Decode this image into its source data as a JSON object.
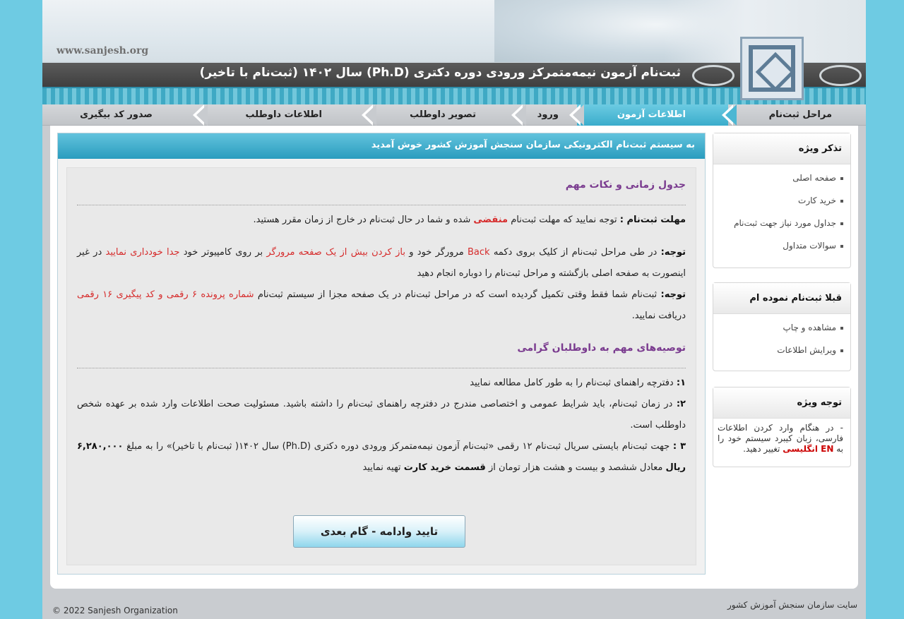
{
  "header": {
    "site_url": "www.sanjesh.org",
    "title": "ثبت‌نام آزمون نیمه‌متمرکز ورودی دوره دکتری (Ph.D) سال ۱۴۰۲ (ثبت‌نام با تاخیر)"
  },
  "nav": {
    "items": [
      {
        "label": "مراحل ثبت‌نام"
      },
      {
        "label": "اطلاعات آزمون"
      },
      {
        "label": "ورود"
      },
      {
        "label": "تصویر داوطلب"
      },
      {
        "label": "اطلاعات داوطلب"
      },
      {
        "label": "صدور کد بیگیری"
      }
    ],
    "active_index": 1
  },
  "sidebar": {
    "boxes": [
      {
        "title": "تذکر ویژه",
        "items": [
          "صفحه اصلی",
          "خرید کارت",
          "جداول مورد نیاز جهت ثبت‌نام",
          "سوالات متداول"
        ]
      },
      {
        "title": "قبلا ثبت‌نام نموده ام",
        "items": [
          "مشاهده و چاپ",
          "ویرایش اطلاعات"
        ]
      }
    ],
    "note_box": {
      "title": "توجه ویژه",
      "text_before": "- در هنگام وارد کردن اطلاعات فارسی، زبان کیبرد سیستم خود را به",
      "en_label": "EN انگلیسی",
      "text_after": "تغییر دهید."
    }
  },
  "main": {
    "welcome": "به سیستم ثبت‌نام الکترونیکی سازمان سنجش آموزش کشور خوش آمدید",
    "section1_title": "جدول زمانی و نکات مهم",
    "deadline": {
      "label": "مهلت ثبت‌نام :",
      "text1": "توجه نمایید که مهلت ثبت‌نام",
      "highlight": "منقضی",
      "text2": "شده و شما در حال ثبت‌نام در خارج از زمان مقرر هستید."
    },
    "note1": {
      "label": "توجه:",
      "t1": "در طی مراحل ثبت‌نام از کلیک بروی دکمه",
      "back": "Back",
      "t2": "مرورگر خود و",
      "r1": "باز کردن بیش از یک صفحه مرورگر",
      "t3": "بر روی کامپیوتر خود",
      "r2": "جدا خودداری نمایید",
      "t4": "در غیر اینصورت به صفحه اصلی بازگشته و مراحل ثبت‌نام را دوباره انجام دهید"
    },
    "note2": {
      "label": "توجه:",
      "t1": "ثبت‌نام شما فقط وقتی تکمیل گردیده است که در مراحل ثبت‌نام در یک صفحه مجزا از سیستم ثبت‌نام",
      "r1": "شماره پرونده ۶ رقمی و کد پیگیری ۱۶ رقمی",
      "t2": "دریافت نمایید."
    },
    "section2_title": "توصیه‌های مهم به داوطلبان گرامی",
    "rec1": {
      "num": "۱:",
      "text": "دفترچه راهنمای ثبت‌نام را به طور کامل مطالعه نمایید"
    },
    "rec2": {
      "num": "۲:",
      "text": "در زمان ثبت‌نام، باید شرایط عمومی و اختصاصی مندرج در دفترچه راهنمای ثبت‌نام را داشته باشید. مسئولیت صحت اطلاعات وارد شده بر عهده شخص داوطلب است."
    },
    "rec3": {
      "num": "۳ :",
      "t1": "جهت ثبت‌نام بایستی سریال ثبت‌نام ۱۲ رقمی «ثبت‌نام آزمون نیمه‌متمرکز ورودی دوره دکتری (Ph.D) سال ۱۴۰۲( ثبت‌نام با تاخیر)» را به مبلغ",
      "amount": "۶,۲۸۰,۰۰۰ ریال",
      "t2": "معادل ششصد و بیست و هشت هزار تومان از",
      "b2": "قسمت خرید کارت",
      "t3": "تهیه نمایید"
    },
    "next_button": "تایید وادامه - گام بعدی"
  },
  "footer": {
    "right": "سایت سازمان سنجش آموزش کشور",
    "left": "© 2022 Sanjesh Organization"
  }
}
